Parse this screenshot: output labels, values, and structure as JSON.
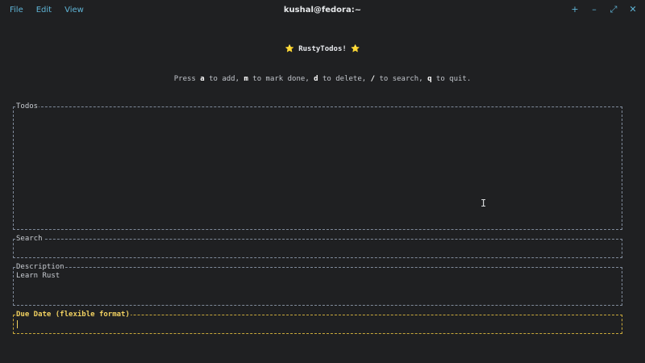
{
  "window": {
    "title": "kushal@fedora:~",
    "menu": [
      "File",
      "Edit",
      "View"
    ],
    "controls": {
      "new_tab": "+",
      "minimize": "–",
      "maximize": "⤢",
      "close": "✕"
    }
  },
  "app": {
    "title": "RustyTodos!",
    "star": "⭐",
    "help": {
      "prefix": "Press ",
      "k1": "a",
      "t1": " to add, ",
      "k2": "m",
      "t2": " to mark done, ",
      "k3": "d",
      "t3": " to delete, ",
      "k4": "/",
      "t4": " to search, ",
      "k5": "q",
      "t5": " to quit."
    }
  },
  "panels": {
    "todos": {
      "label": "Todos"
    },
    "search": {
      "label": "Search",
      "value": ""
    },
    "description": {
      "label": "Description",
      "value": "Learn Rust"
    },
    "due_date": {
      "label": "Due Date (flexible format)",
      "value": ""
    }
  },
  "colors": {
    "background": "#1f2022",
    "accent": "#5fb4d6",
    "active_border": "#c9a93a",
    "active_label": "#f0d060",
    "border": "#7f8a9a"
  }
}
